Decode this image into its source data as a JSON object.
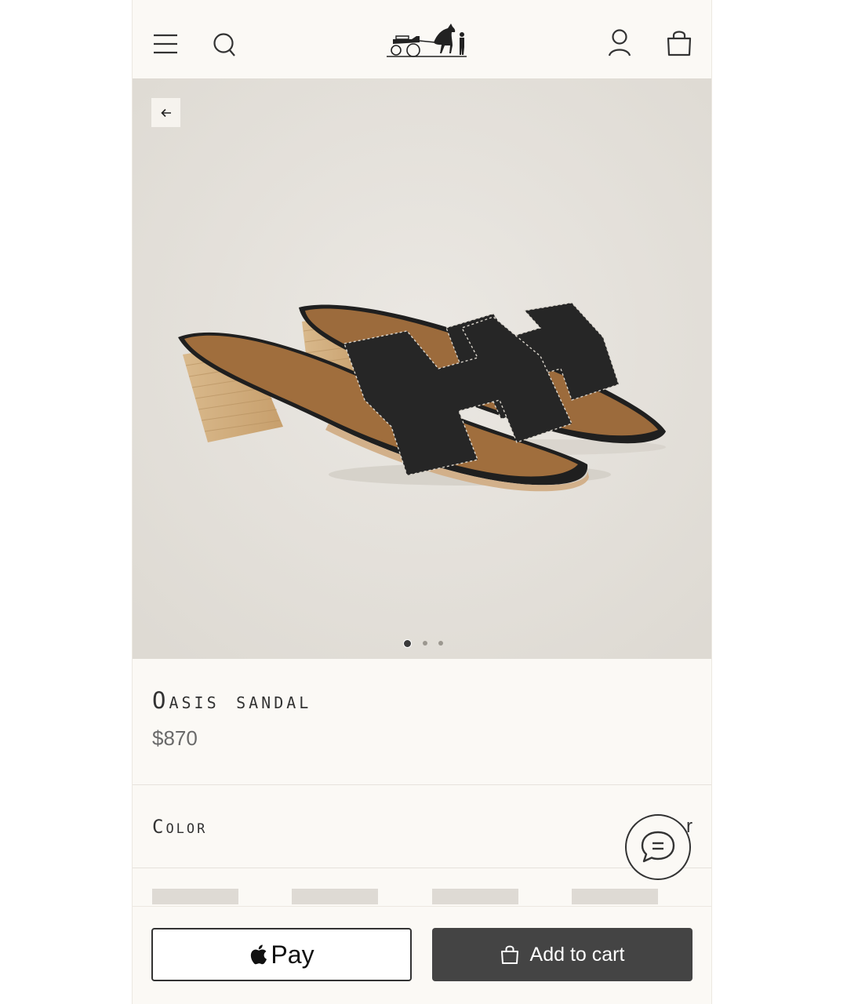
{
  "header": {
    "menu_icon": "hamburger-menu-icon",
    "search_icon": "search-icon",
    "logo": "carriage-logo",
    "account_icon": "user-icon",
    "bag_icon": "shopping-bag-icon"
  },
  "gallery": {
    "back_icon": "arrow-left-icon",
    "image": "black leather heeled sandals",
    "dots_total": 3,
    "active_dot": 1
  },
  "product": {
    "title": "Oasis sandal",
    "price": "$870"
  },
  "color": {
    "label": "Color",
    "value": "r"
  },
  "chat": {
    "icon": "chat-bubble-icon"
  },
  "actions": {
    "apple_pay_label": "Pay",
    "add_to_cart_label": "Add to cart"
  },
  "colors": {
    "background": "#fbf9f5",
    "gallery_bg": "#e5e1db",
    "button_dark": "#444444",
    "text": "#333333"
  }
}
